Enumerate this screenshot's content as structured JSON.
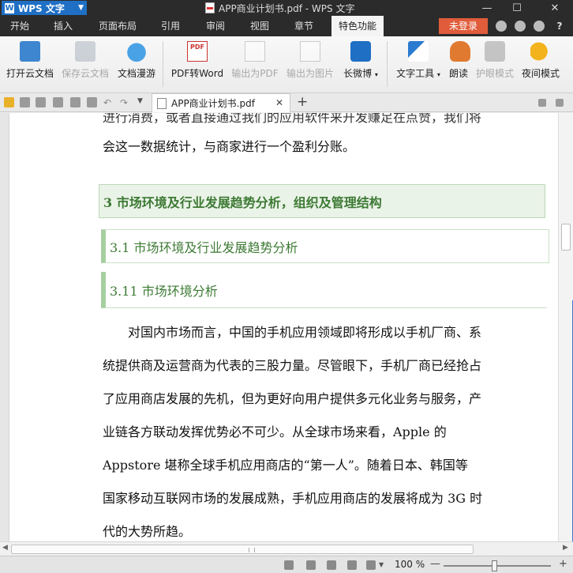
{
  "titlebar": {
    "app_name": "WPS 文字",
    "window_title": "APP商业计划书.pdf - WPS 文字",
    "minimize": "—",
    "maximize": "☐",
    "close": "✕"
  },
  "menu": {
    "items": [
      "开始",
      "插入",
      "页面布局",
      "引用",
      "审阅",
      "视图",
      "章节",
      "特色功能"
    ],
    "active": "特色功能",
    "login": "未登录",
    "help": "?"
  },
  "ribbon": {
    "buttons": [
      {
        "label": "打开云文档",
        "icon": "cloud-folder-icon",
        "enabled": true
      },
      {
        "label": "保存云文档",
        "icon": "cloud-save-icon",
        "enabled": false
      },
      {
        "label": "文档漫游",
        "icon": "cloud-icon",
        "enabled": true
      },
      {
        "label": "PDF转Word",
        "icon": "pdf-icon",
        "enabled": true
      },
      {
        "label": "输出为PDF",
        "icon": "export-pdf-icon",
        "enabled": false
      },
      {
        "label": "输出为图片",
        "icon": "export-image-icon",
        "enabled": false
      },
      {
        "label": "长微博",
        "icon": "weibo-icon",
        "enabled": true
      },
      {
        "label": "文字工具",
        "icon": "text-tools-icon",
        "enabled": true
      },
      {
        "label": "朗读",
        "icon": "microphone-icon",
        "enabled": true
      },
      {
        "label": "护眼模式",
        "icon": "eye-care-icon",
        "enabled": false
      },
      {
        "label": "夜间模式",
        "icon": "moon-icon",
        "enabled": true
      }
    ]
  },
  "tabs": {
    "doc_tab": "APP商业计划书.pdf",
    "new_tab": "+"
  },
  "document": {
    "line_top": "进行消费，或者直接通过我们的应用软件来开发赚足在点赞，我们将",
    "line_prev": "会这一数据统计，与商家进行一个盈利分账。",
    "heading1": "3 市场环境及行业发展趋势分析，组织及管理结构",
    "heading2": "3.1 市场环境及行业发展趋势分析",
    "heading3": "3.11 市场环境分析",
    "paragraph": [
      "　　对国内市场而言，中国的手机应用领域即将形成以手机厂商、系",
      "统提供商及运营商为代表的三股力量。尽管眼下，手机厂商已经抢占",
      "了应用商店发展的先机，但为更好向用户提供多元化业务与服务，产",
      "业链各方联动发挥优势必不可少。从全球市场来看，Apple 的",
      "Appstore 堪称全球手机应用商店的“第一人”。随着日本、韩国等",
      "国家移动互联网市场的发展成熟，手机应用商店的发展将成为 3G 时",
      "代的大势所趋。"
    ]
  },
  "statusbar": {
    "zoom": "100 %",
    "zoom_minus": "—",
    "zoom_plus": "+",
    "zoom_fraction": 0.47
  }
}
